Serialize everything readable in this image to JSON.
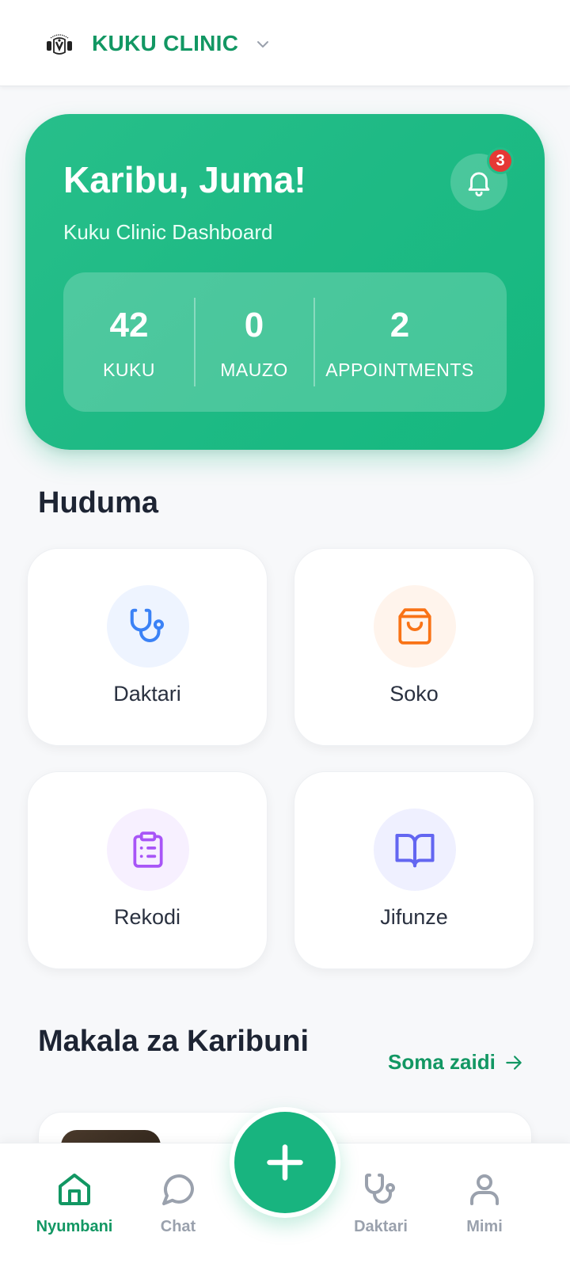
{
  "header": {
    "brand": "KUKU CLINIC",
    "logo_icon": "rooster-logo-icon",
    "dropdown_icon": "chevron-down-icon"
  },
  "hero": {
    "greeting": "Karibu, Juma!",
    "subtitle": "Kuku Clinic Dashboard",
    "notification_count": "3",
    "stats": [
      {
        "value": "42",
        "label": "KUKU"
      },
      {
        "value": "0",
        "label": "MAUZO"
      },
      {
        "value": "2",
        "label": "APPOINTMENTS"
      }
    ]
  },
  "services": {
    "title": "Huduma",
    "items": [
      {
        "label": "Daktari",
        "icon": "stethoscope-icon",
        "color": "#3b82f6",
        "bg": "#eef4ff"
      },
      {
        "label": "Soko",
        "icon": "shopping-bag-icon",
        "color": "#f97316",
        "bg": "#fff4ec"
      },
      {
        "label": "Rekodi",
        "icon": "clipboard-list-icon",
        "color": "#a855f7",
        "bg": "#f7f0ff"
      },
      {
        "label": "Jifunze",
        "icon": "book-open-icon",
        "color": "#6366f1",
        "bg": "#eff0ff"
      }
    ]
  },
  "articles": {
    "title": "Makala za Karibuni",
    "read_more": "Soma zaidi"
  },
  "bottom_nav": {
    "items": [
      {
        "label": "Nyumbani",
        "icon": "home-icon",
        "active": true
      },
      {
        "label": "Chat",
        "icon": "chat-bubble-icon",
        "active": false
      },
      {
        "label": "Daktari",
        "icon": "stethoscope-icon",
        "active": false
      },
      {
        "label": "Mimi",
        "icon": "user-icon",
        "active": false
      }
    ],
    "fab_icon": "plus-icon"
  },
  "colors": {
    "brand_green": "#129763",
    "accent_green": "#18b47f",
    "badge_red": "#e53935",
    "inactive_gray": "#9aa1ad"
  }
}
